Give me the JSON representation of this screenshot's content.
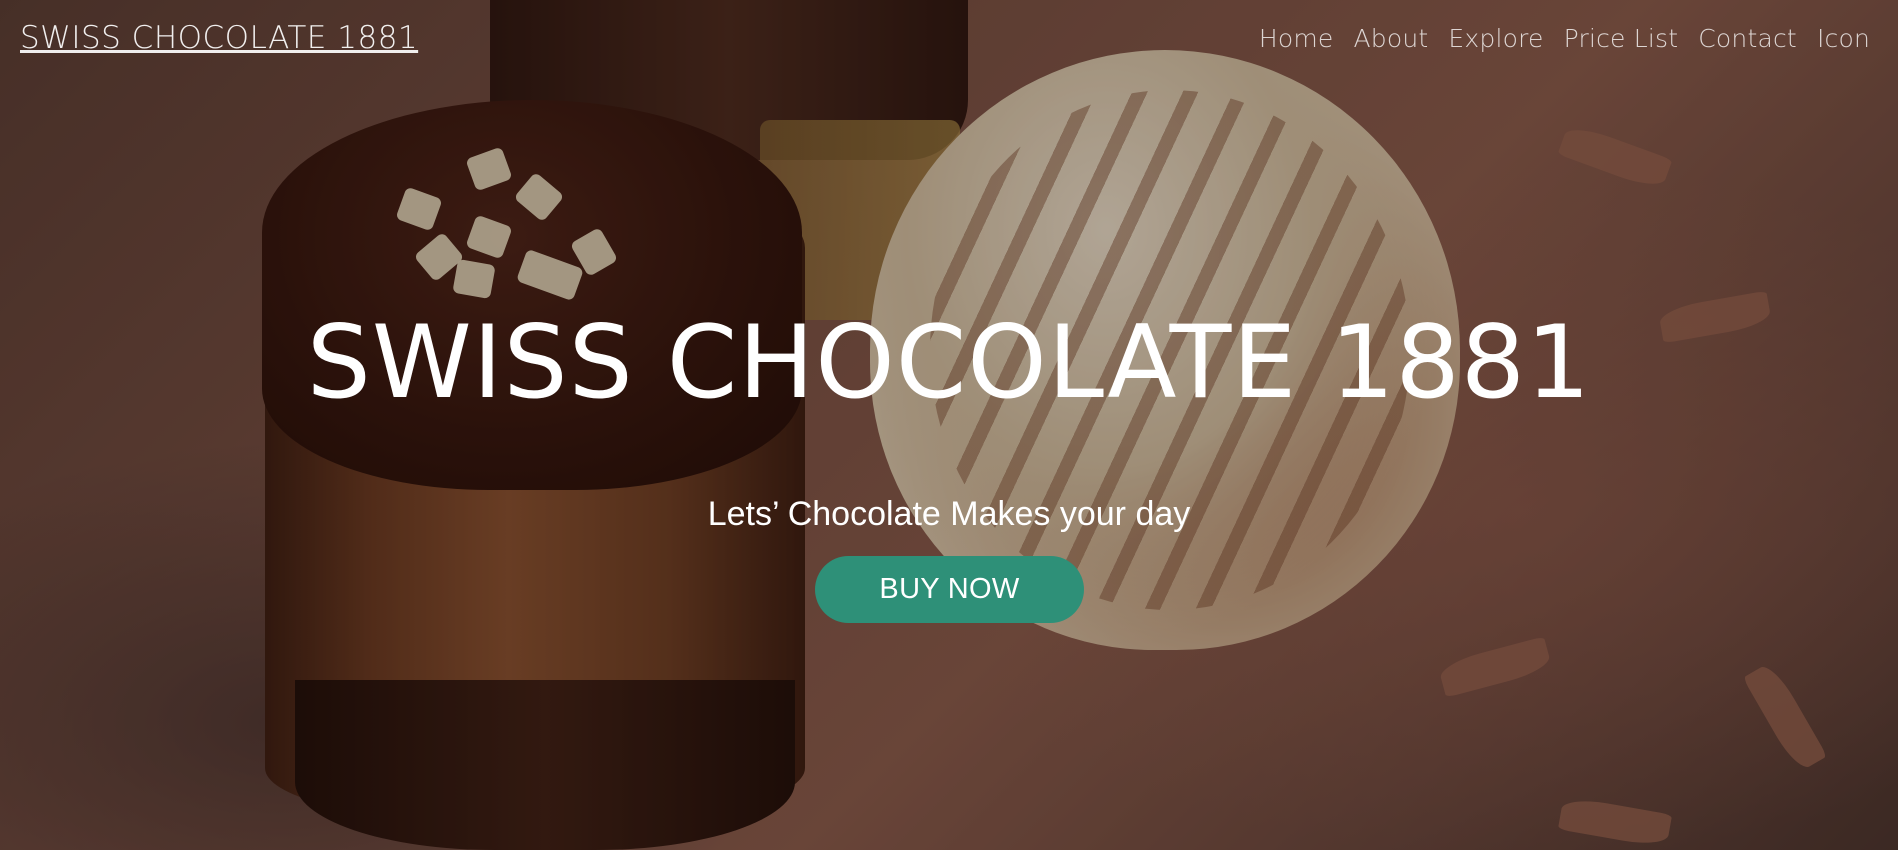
{
  "brand": {
    "name": "SWISS CHOCOLATE 1881"
  },
  "nav": {
    "items": [
      {
        "label": "Home"
      },
      {
        "label": "About"
      },
      {
        "label": "Explore"
      },
      {
        "label": "Price List"
      },
      {
        "label": "Contact"
      },
      {
        "label": "Icon"
      }
    ]
  },
  "hero": {
    "title": "SWISS CHOCOLATE 1881",
    "subtitle": "Lets’ Chocolate Makes your day",
    "cta_label": "BUY NOW",
    "cta_color": "#2e9078",
    "background_image": "chocolate desserts photo"
  }
}
